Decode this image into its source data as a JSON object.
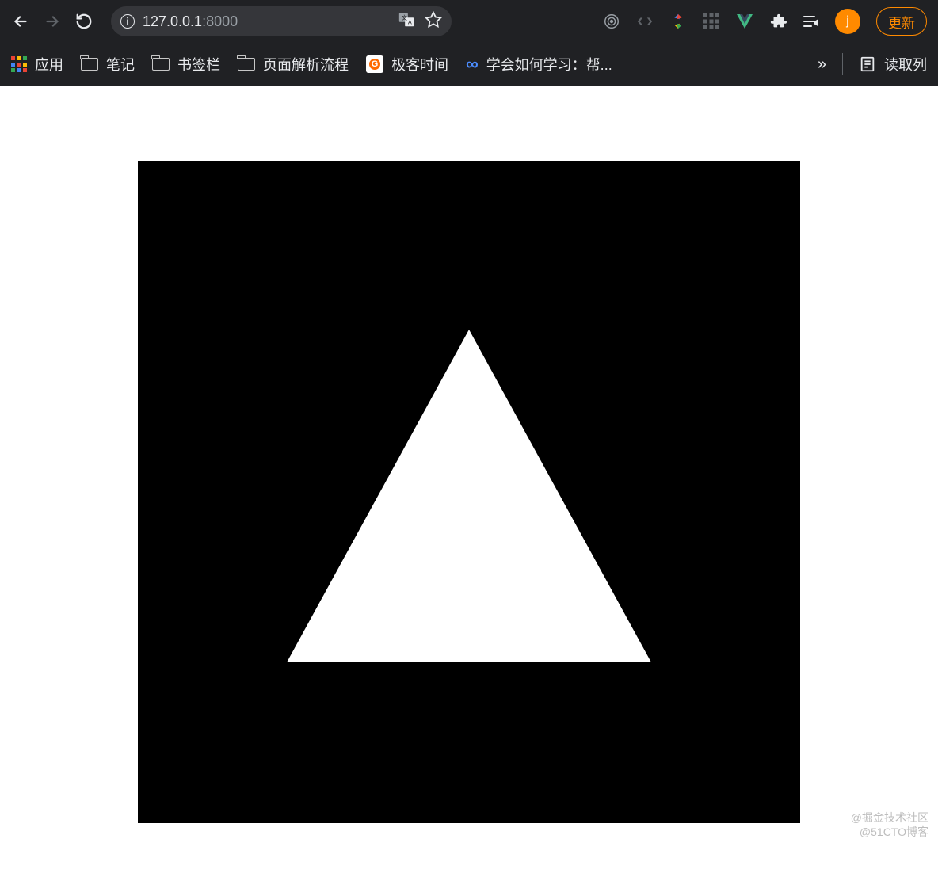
{
  "toolbar": {
    "url_host": "127.0.0.1",
    "url_port": ":8000",
    "update_label": "更新"
  },
  "bookmarks": {
    "apps": "应用",
    "items": [
      {
        "label": "笔记"
      },
      {
        "label": "书签栏"
      },
      {
        "label": "页面解析流程"
      }
    ],
    "geek": "极客时间",
    "learn": "学会如何学习：帮...",
    "reading_list": "读取列"
  },
  "avatar_initial": "j",
  "watermark_line1": "@掘金技术社区",
  "watermark_line2": "@51CTO博客"
}
